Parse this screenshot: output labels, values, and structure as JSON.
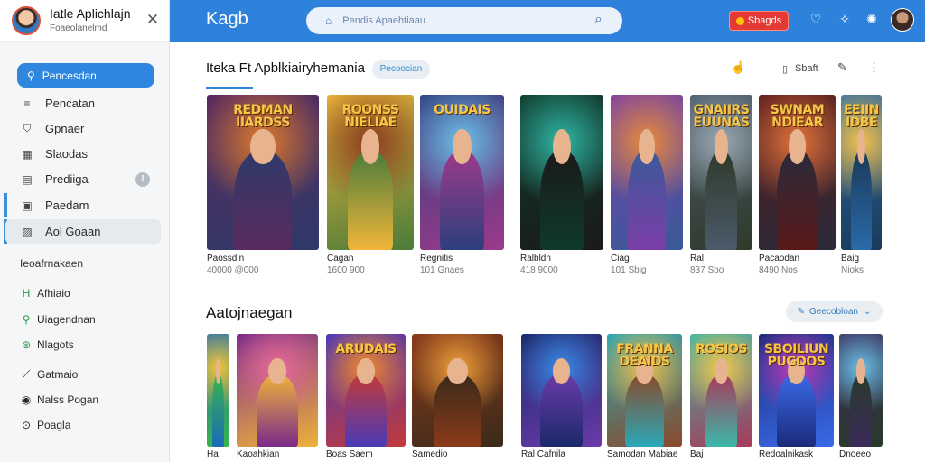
{
  "sidebar": {
    "user_name": "Iatle Aplichlajn",
    "user_sub": "Foaeolanelmd",
    "close_icon": "✕",
    "active_item": {
      "icon": "pin-icon",
      "glyph": "⚲",
      "label": "Pencesdan"
    },
    "items": [
      {
        "icon": "list-icon",
        "glyph": "≡",
        "label": "Pencatan"
      },
      {
        "icon": "shield-icon",
        "glyph": "⛉",
        "label": "Gpnaer"
      },
      {
        "icon": "grid-icon",
        "glyph": "▦",
        "label": "Slaodas"
      },
      {
        "icon": "document-icon",
        "glyph": "▤",
        "label": "Prediiga",
        "badge": "!"
      },
      {
        "icon": "calendar-icon",
        "glyph": "▣",
        "label": "Paedam"
      },
      {
        "icon": "image-icon",
        "glyph": "▨",
        "label": "Aol Goaan"
      }
    ],
    "section_label": "Ieoafrnakaen",
    "section_items": [
      {
        "icon": "h-icon",
        "glyph": "H",
        "label": "Afhiaio"
      },
      {
        "icon": "search-icon",
        "glyph": "⚲",
        "label": "Uiagendnan"
      },
      {
        "icon": "gamepad-icon",
        "glyph": "⊛",
        "label": "Nlagots"
      },
      {
        "icon": "wand-icon",
        "glyph": "⟋",
        "label": "Gatmaio"
      },
      {
        "icon": "user-icon",
        "glyph": "◉",
        "label": "Nalss Pogan"
      },
      {
        "icon": "circle-icon",
        "glyph": "⊙",
        "label": "Poagla"
      }
    ]
  },
  "topbar": {
    "brand": "Kagb",
    "search_lead": "⌂",
    "search_placeholder": "Pendis Apaehtiaau",
    "search_icon": "⌕",
    "cta_label": "Sbagds",
    "icons": [
      {
        "name": "heart-icon",
        "glyph": "♡"
      },
      {
        "name": "sparkle-icon",
        "glyph": "✧"
      },
      {
        "name": "lightbulb-icon",
        "glyph": "✺"
      }
    ]
  },
  "main": {
    "section1_title": "Iteka Ft Apblkiairyhemania",
    "section1_chip": "Pecoocian",
    "actions": [
      {
        "name": "thumbs-up-icon",
        "glyph": "☝"
      },
      {
        "name": "bookmark-icon",
        "glyph": "▯"
      },
      {
        "name": "brush-icon",
        "glyph": "✎"
      },
      {
        "name": "more-icon",
        "glyph": "⋮"
      }
    ],
    "action_label": "Sbaft",
    "row1": [
      {
        "title": "REDMAN\nIIARDSS",
        "name": "Paossdin",
        "meta": "40000 @000",
        "palette": [
          "#5a2a5e",
          "#e07a2a",
          "#2e3a6a"
        ]
      },
      {
        "title": "ROONSS\nNIELIAE",
        "name": "Cagan",
        "meta": "1600 900",
        "palette": [
          "#f0b63a",
          "#8a3b1e",
          "#4a7b3a"
        ]
      },
      {
        "title": "OUIDAIS",
        "name": "Regnitis",
        "meta": "101 Gnaes",
        "palette": [
          "#2d3f7d",
          "#6cc1e8",
          "#9c3a8a"
        ]
      },
      {
        "title": "",
        "name": "Ralbldn",
        "meta": "418 9000",
        "palette": [
          "#0f3a2a",
          "#2fb7a6",
          "#1a1a1a"
        ]
      },
      {
        "title": "",
        "name": "Ciag",
        "meta": "101 Sbig",
        "palette": [
          "#7c3da8",
          "#e88a3a",
          "#3a5a9a"
        ]
      },
      {
        "title": "GNAIIRS\nEUUNAS",
        "name": "Ral",
        "meta": "837 Sbo",
        "palette": [
          "#4a5a6a",
          "#9aa8b3",
          "#2f3a2a"
        ]
      },
      {
        "title": "SWNAM\nNDIEAR",
        "name": "Pacaodan",
        "meta": "8490 Nos",
        "palette": [
          "#5a1a1a",
          "#e2733a",
          "#2a2a3a"
        ]
      },
      {
        "title": "EEIIN\nIDBE",
        "name": "Baig",
        "meta": "Nioks",
        "palette": [
          "#2a6aa8",
          "#f2c14a",
          "#1a3a5a"
        ]
      }
    ],
    "section2_title": "Aatojnaegan",
    "filter_label": "Geecobloan",
    "filter_icon": "✎",
    "filter_caret": "⌄",
    "row2": [
      {
        "title": "",
        "name": "Ha",
        "palette": [
          "#1a6ab8",
          "#f0c23a",
          "#3ab54a"
        ]
      },
      {
        "title": "",
        "name": "Kaoahkian",
        "palette": [
          "#7a2a8a",
          "#e86a9a",
          "#f0b23a"
        ]
      },
      {
        "title": "ARUDAIS",
        "name": "Boas Saem",
        "palette": [
          "#4a3ab8",
          "#f08a2a",
          "#c23a3a"
        ]
      },
      {
        "title": "",
        "name": "Samedio",
        "palette": [
          "#8a3a1a",
          "#f0a03a",
          "#3a2a1a"
        ]
      },
      {
        "title": "",
        "name": "Ral Cafnila",
        "palette": [
          "#1a2a6a",
          "#3a8ae8",
          "#6a3aa8"
        ]
      },
      {
        "title": "FRANNA\nDEAIDS",
        "name": "Samodan Mabiae",
        "palette": [
          "#2aa8b8",
          "#f0c04a",
          "#8a4a2a"
        ]
      },
      {
        "title": "ROSIOS",
        "name": "Baj",
        "palette": [
          "#3ab8a8",
          "#f2c84a",
          "#a83a5a"
        ]
      },
      {
        "title": "SBOILIUN\nPUGDOS",
        "name": "Redoalnikask",
        "palette": [
          "#1a2a7a",
          "#c23ab8",
          "#3a6ae8"
        ]
      },
      {
        "title": "",
        "name": "Dnoeeo",
        "palette": [
          "#3a2a5a",
          "#6ac0e8",
          "#2a3a2a"
        ]
      }
    ]
  }
}
